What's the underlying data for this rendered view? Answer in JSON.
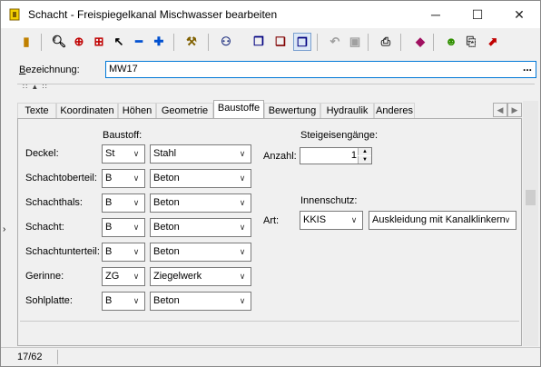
{
  "window": {
    "title": "Schacht - Freispiegelkanal Mischwasser bearbeiten",
    "controls": {
      "minimize": "─",
      "maximize": "☐",
      "close": "✕"
    }
  },
  "toolbar": [
    {
      "name": "exit-icon",
      "glyph": "▮",
      "color": "#c08000"
    },
    {
      "name": "zoom-icon",
      "glyph": "🔍︎",
      "color": "#000000"
    },
    {
      "name": "zoom-target-icon",
      "glyph": "⊕",
      "color": "#c00000"
    },
    {
      "name": "crosshair-icon",
      "glyph": "⊞",
      "color": "#c00000"
    },
    {
      "name": "pointer-icon",
      "glyph": "↖",
      "color": "#000000"
    },
    {
      "name": "minus-icon",
      "glyph": "━",
      "color": "#0050d0"
    },
    {
      "name": "plus-icon",
      "glyph": "✚",
      "color": "#0050d0"
    },
    {
      "name": "tools-icon",
      "glyph": "⚒",
      "color": "#806000"
    },
    {
      "name": "network-icon",
      "glyph": "⚇",
      "color": "#203080"
    },
    {
      "name": "window-stack-icon",
      "glyph": "❐",
      "color": "#000080"
    },
    {
      "name": "window-close-icon",
      "glyph": "❏",
      "color": "#800000"
    },
    {
      "name": "window-cascade-icon",
      "glyph": "❐",
      "color": "#000080"
    },
    {
      "name": "undo-icon",
      "glyph": "↶",
      "color": "#a0a0a0"
    },
    {
      "name": "save-icon",
      "glyph": "▣",
      "color": "#a0a0a0"
    },
    {
      "name": "print-icon",
      "glyph": "⎙",
      "color": "#303030"
    },
    {
      "name": "book-icon",
      "glyph": "◆",
      "color": "#a01060"
    },
    {
      "name": "user-icon",
      "glyph": "☻",
      "color": "#309000"
    },
    {
      "name": "document-icon",
      "glyph": "⎘",
      "color": "#303030"
    },
    {
      "name": "chart-icon",
      "glyph": "⬈",
      "color": "#c00000"
    }
  ],
  "bezeichnung": {
    "label": "Bezeichnung:",
    "underline": "B",
    "rest": "ezeichnung:",
    "value": "MW17",
    "more": "..."
  },
  "tabs": [
    "Texte",
    "Koordinaten",
    "Höhen",
    "Geometrie",
    "Baustoffe",
    "Bewertung",
    "Hydraulik",
    "Anderes"
  ],
  "active_tab": "Baustoffe",
  "baustoffe": {
    "header": "Baustoff:",
    "rows": [
      {
        "label": "Deckel:",
        "code": "St",
        "material": "Stahl"
      },
      {
        "label": "Schachtoberteil:",
        "code": "B",
        "material": "Beton"
      },
      {
        "label": "Schachthals:",
        "code": "B",
        "material": "Beton"
      },
      {
        "label": "Schacht:",
        "code": "B",
        "material": "Beton"
      },
      {
        "label": "Schachtunterteil:",
        "code": "B",
        "material": "Beton"
      },
      {
        "label": "Gerinne:",
        "code": "ZG",
        "material": "Ziegelwerk"
      },
      {
        "label": "Sohlplatte:",
        "code": "B",
        "material": "Beton"
      }
    ]
  },
  "steigeisen": {
    "header": "Steigeisengänge:",
    "anzahl_label": "Anzahl:",
    "anzahl": "1"
  },
  "innenschutz": {
    "header": "Innenschutz:",
    "art_label": "Art:",
    "code": "KKIS",
    "value": "Auskleidung mit Kanalklinkern"
  },
  "status": {
    "record": "17/62"
  }
}
